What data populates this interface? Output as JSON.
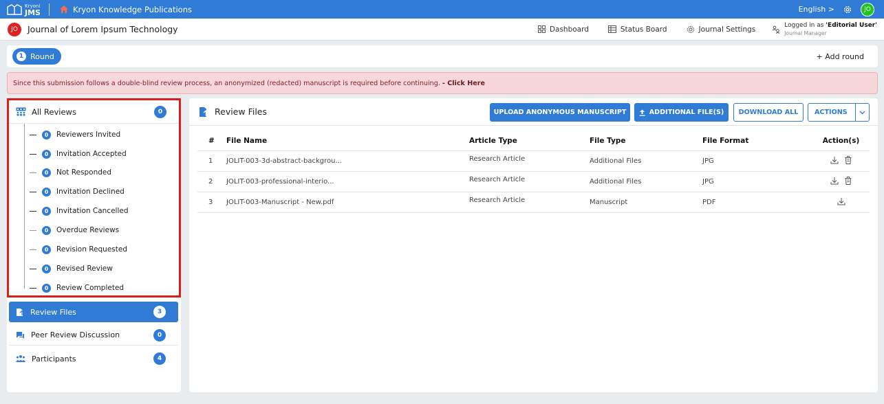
{
  "topbar": {
    "logo_small": "Kryoni",
    "logo_big": "JMS",
    "publisher": "Kryon Knowledge Publications",
    "language": "English >",
    "user_initials": "JO"
  },
  "journalbar": {
    "avatar_initials": "JO",
    "journal_title": "Journal of Lorem Ipsum Technology",
    "nav": {
      "dashboard": "Dashboard",
      "status_board": "Status Board",
      "journal_settings": "Journal Settings"
    },
    "logged_prefix": "Logged in as ",
    "logged_user": "'Editorial User'",
    "logged_role": "Journal Manager"
  },
  "rounds": {
    "round_number": "1",
    "round_label": "Round",
    "add_round": "+ Add round"
  },
  "alert": {
    "message": "Since this submission follows a double-blind review process, an anonymized (redacted) manuscript is required before continuing.",
    "link": "- Click Here"
  },
  "sidebar": {
    "all_reviews": {
      "label": "All Reviews",
      "count": "0"
    },
    "review_statuses": [
      {
        "label": "Reviewers Invited",
        "count": "0"
      },
      {
        "label": "Invitation Accepted",
        "count": "0"
      },
      {
        "label": "Not Responded",
        "count": "0"
      },
      {
        "label": "Invitation Declined",
        "count": "0"
      },
      {
        "label": "Invitation Cancelled",
        "count": "0"
      },
      {
        "label": "Overdue Reviews",
        "count": "0"
      },
      {
        "label": "Revision Requested",
        "count": "0"
      },
      {
        "label": "Revised Review",
        "count": "0"
      },
      {
        "label": "Review Completed",
        "count": "0"
      }
    ],
    "sections": [
      {
        "label": "Review Files",
        "count": "3"
      },
      {
        "label": "Peer Review Discussion",
        "count": "0"
      },
      {
        "label": "Participants",
        "count": "4"
      }
    ]
  },
  "main": {
    "title": "Review Files",
    "buttons": {
      "upload_anonymous": "UPLOAD ANONYMOUS MANUSCRIPT",
      "additional_files": "ADDITIONAL FILE(S)",
      "download_all": "DOWNLOAD ALL",
      "actions": "ACTIONS"
    },
    "table": {
      "headers": [
        "#",
        "File Name",
        "Article Type",
        "File Type",
        "File Format",
        "Action(s)"
      ],
      "rows": [
        {
          "num": "1",
          "file_name": "JOLIT-003-3d-abstract-backgrou...",
          "article_type": "Research Article",
          "file_type": "Additional Files",
          "file_format": "JPG"
        },
        {
          "num": "2",
          "file_name": "JOLIT-003-professional-interio...",
          "article_type": "Research Article",
          "file_type": "Additional Files",
          "file_format": "JPG"
        },
        {
          "num": "3",
          "file_name": "JOLIT-003-Manuscript - New.pdf",
          "article_type": "Research Article",
          "file_type": "Manuscript",
          "file_format": "PDF"
        }
      ]
    }
  },
  "colors": {
    "primary": "#2f7bd6",
    "highlight_border": "#dd1c1c",
    "alert_bg": "#f8d7da",
    "avatar_green": "#1ec31e",
    "avatar_red": "#e02020"
  }
}
